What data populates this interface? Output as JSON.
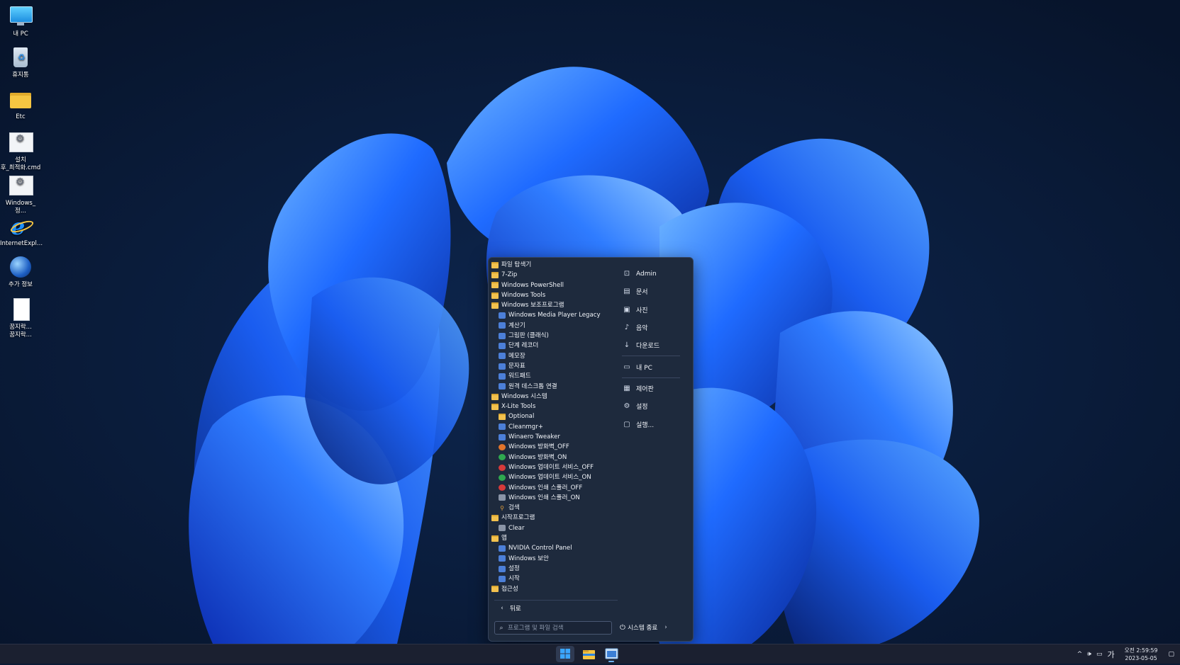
{
  "desktop": {
    "icons": [
      {
        "label": "내 PC",
        "icon": "monitor-icon"
      },
      {
        "label": "휴지통",
        "icon": "recycle-bin-icon"
      },
      {
        "label": "Etc",
        "icon": "folder-icon"
      },
      {
        "label_line1": "설치",
        "label_line2": "후_최적화.cmd",
        "icon": "cmd-gear-icon"
      },
      {
        "label": "Windows_정...",
        "icon": "cmd-gear-icon"
      },
      {
        "label": "InternetExpl...",
        "icon": "internet-explorer-icon"
      },
      {
        "label": "추가 정보",
        "icon": "globe-info-icon"
      },
      {
        "label_line1": "꿈지락...",
        "label_line2": "꿈지락...",
        "icon": "file-icon"
      }
    ]
  },
  "start_menu": {
    "programs": [
      {
        "label": "파일 탐색기",
        "level": 0,
        "icon": "file-explorer-icon"
      },
      {
        "label": "7-Zip",
        "level": 0,
        "icon": "folder-icon"
      },
      {
        "label": "Windows PowerShell",
        "level": 0,
        "icon": "folder-icon"
      },
      {
        "label": "Windows Tools",
        "level": 0,
        "icon": "folder-icon"
      },
      {
        "label": "Windows 보조프로그램",
        "level": 0,
        "icon": "folder-icon"
      },
      {
        "label": "Windows Media Player Legacy",
        "level": 1,
        "icon": "media-player-icon"
      },
      {
        "label": "계산기",
        "level": 1,
        "icon": "calculator-icon"
      },
      {
        "label": "그림판 (클래식)",
        "level": 1,
        "icon": "paint-icon"
      },
      {
        "label": "단계 레코더",
        "level": 1,
        "icon": "steps-recorder-icon"
      },
      {
        "label": "메모장",
        "level": 1,
        "icon": "notepad-icon"
      },
      {
        "label": "문자표",
        "level": 1,
        "icon": "charmap-icon"
      },
      {
        "label": "워드패드",
        "level": 1,
        "icon": "wordpad-icon"
      },
      {
        "label": "원격 데스크톱 연결",
        "level": 1,
        "icon": "remote-desktop-icon"
      },
      {
        "label": "Windows 시스템",
        "level": 0,
        "icon": "folder-icon"
      },
      {
        "label": "X-Lite Tools",
        "level": 0,
        "icon": "folder-icon"
      },
      {
        "label": "Optional",
        "level": 1,
        "icon": "folder-icon"
      },
      {
        "label": "Cleanmgr+",
        "level": 1,
        "icon": "cleanmgr-icon"
      },
      {
        "label": "Winaero Tweaker",
        "level": 1,
        "icon": "winaero-icon"
      },
      {
        "label": "Windows 방화벽_OFF",
        "level": 1,
        "icon": "shield-off-icon"
      },
      {
        "label": "Windows 방화벽_ON",
        "level": 1,
        "icon": "shield-on-icon"
      },
      {
        "label": "Windows 업데이트 서비스_OFF",
        "level": 1,
        "icon": "red-x-icon"
      },
      {
        "label": "Windows 업데이트 서비스_ON",
        "level": 1,
        "icon": "green-check-icon"
      },
      {
        "label": "Windows 인쇄 스풀러_OFF",
        "level": 1,
        "icon": "no-entry-icon"
      },
      {
        "label": "Windows 인쇄 스풀러_ON",
        "level": 1,
        "icon": "printer-icon"
      },
      {
        "label": "검색",
        "level": 1,
        "icon": "search-icon"
      },
      {
        "label": "시작프로그램",
        "level": 0,
        "icon": "folder-icon"
      },
      {
        "label": "Clear",
        "level": 1,
        "icon": "clear-icon"
      },
      {
        "label": "앱",
        "level": 0,
        "icon": "folder-icon"
      },
      {
        "label": "NVIDIA Control Panel",
        "level": 1,
        "icon": "nvidia-icon"
      },
      {
        "label": "Windows 보안",
        "level": 1,
        "icon": "windows-security-icon"
      },
      {
        "label": "설정",
        "level": 1,
        "icon": "settings-gear-icon"
      },
      {
        "label": "시작",
        "level": 1,
        "icon": "start-icon"
      },
      {
        "label": "접근성",
        "level": 0,
        "icon": "folder-icon"
      }
    ],
    "places": [
      {
        "label": "Admin",
        "icon": "user-icon",
        "glyph": "⊡"
      },
      {
        "label": "문서",
        "icon": "document-icon",
        "glyph": "▤"
      },
      {
        "label": "사진",
        "icon": "picture-icon",
        "glyph": "▣"
      },
      {
        "label": "음악",
        "icon": "music-icon",
        "glyph": "♪"
      },
      {
        "label": "다운로드",
        "icon": "download-icon",
        "glyph": "↓"
      },
      {
        "label": "내 PC",
        "icon": "computer-icon",
        "glyph": "▭"
      },
      {
        "label": "제어판",
        "icon": "control-panel-icon",
        "glyph": "▦"
      },
      {
        "label": "설정",
        "icon": "gear-icon",
        "glyph": "⚙"
      },
      {
        "label": "실행...",
        "icon": "run-icon",
        "glyph": "▢"
      }
    ],
    "back_label": "뒤로",
    "search_placeholder": "프로그램 및 파일 검색",
    "shutdown_label": "시스템 종료"
  },
  "taskbar": {
    "tray_ime": "가",
    "clock_time": "오전 2:59:59",
    "clock_date": "2023-05-05"
  },
  "colors": {
    "menu_background": "#1e2a3d",
    "taskbar_background": "#1b2030",
    "wallpaper_accent": "#1f6bff"
  }
}
